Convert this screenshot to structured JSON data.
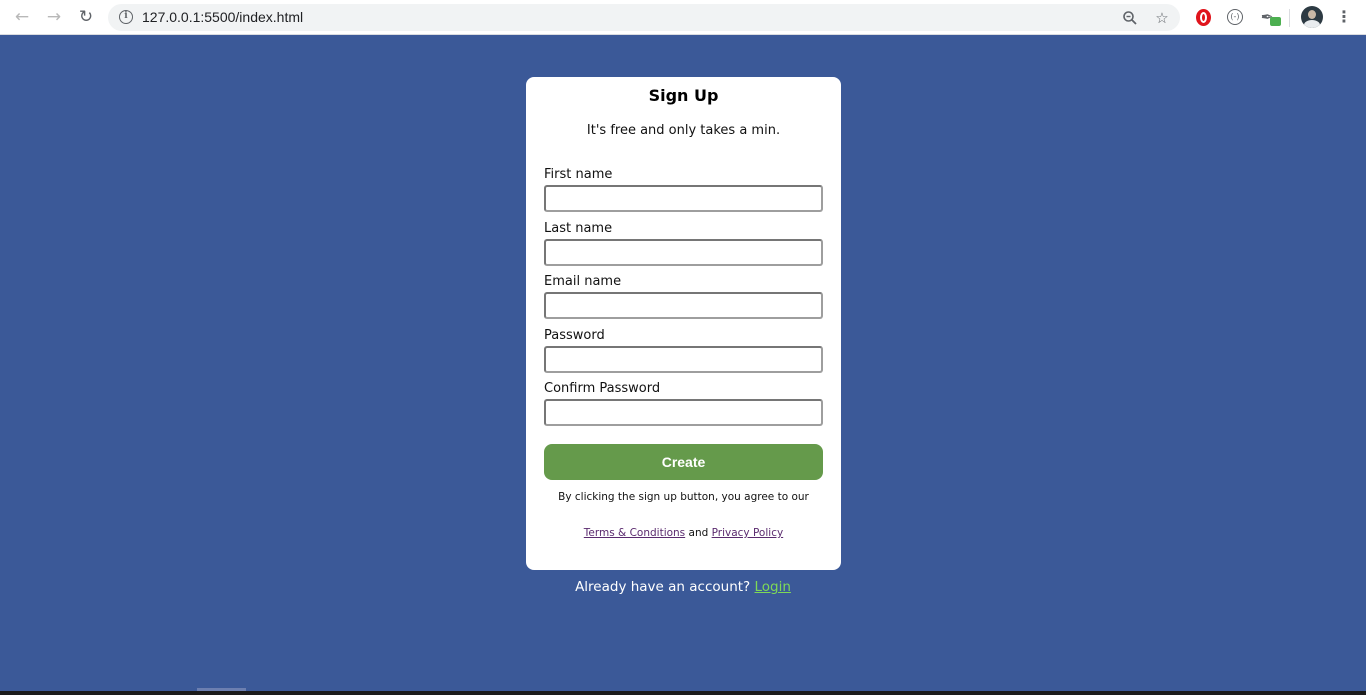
{
  "browser": {
    "url": "127.0.0.1:5500/index.html"
  },
  "signup": {
    "title": "Sign Up",
    "subtitle": "It's free and only takes a min.",
    "fields": [
      {
        "label": "First name",
        "value": ""
      },
      {
        "label": "Last name",
        "value": ""
      },
      {
        "label": "Email name",
        "value": ""
      },
      {
        "label": "Password",
        "value": ""
      },
      {
        "label": "Confirm Password",
        "value": ""
      }
    ],
    "create_label": "Create",
    "agree_text": "By clicking the sign up button, you agree to our",
    "terms_link": "Terms & Conditions",
    "and_text": "and",
    "privacy_link": "Privacy Policy"
  },
  "login_prompt": {
    "text": "Already have an account?",
    "link": "Login"
  },
  "colors": {
    "background": "#3b5998",
    "button": "#659a4b",
    "login_link": "#7ed957",
    "policy_links": "#5a2a6e"
  }
}
